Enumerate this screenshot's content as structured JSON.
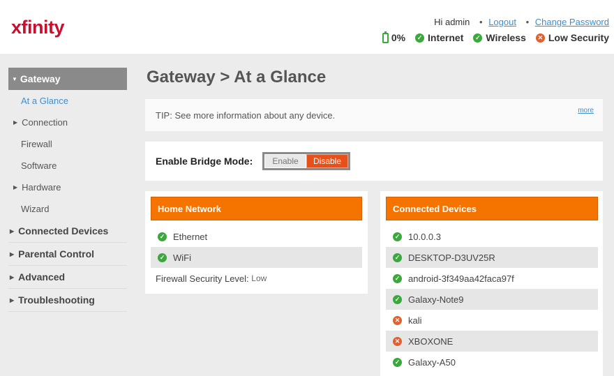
{
  "header": {
    "logo": "xfinity",
    "greeting": "Hi admin",
    "logout": "Logout",
    "change_password": "Change Password",
    "status": {
      "battery": "0%",
      "internet": "Internet",
      "wireless": "Wireless",
      "security": "Low Security"
    }
  },
  "sidebar": {
    "gateway": "Gateway",
    "sub_items": {
      "at_a_glance": "At a Glance",
      "connection": "Connection",
      "firewall": "Firewall",
      "software": "Software",
      "hardware": "Hardware",
      "wizard": "Wizard"
    },
    "main_items": {
      "connected_devices": "Connected Devices",
      "parental_control": "Parental Control",
      "advanced": "Advanced",
      "troubleshooting": "Troubleshooting"
    }
  },
  "main": {
    "title": "Gateway > At a Glance",
    "tip": "TIP: See more information about any device.",
    "more": "more",
    "bridge_label": "Enable Bridge Mode:",
    "bridge_enable": "Enable",
    "bridge_disable": "Disable",
    "home_network": {
      "title": "Home Network",
      "items": [
        "Ethernet",
        "WiFi"
      ],
      "firewall_label": "Firewall Security Level:",
      "firewall_value": "Low"
    },
    "connected_devices": {
      "title": "Connected Devices",
      "devices": [
        "10.0.0.3",
        "DESKTOP-D3UV25R",
        "android-3f349aa42faca97f",
        "Galaxy-Note9",
        "kali",
        "XBOXONE",
        "Galaxy-A50"
      ]
    }
  },
  "colors": {
    "accent_orange": "#f57400",
    "ok_green": "#3aa83a",
    "bad_red": "#e06030",
    "link_blue": "#3d8fd1"
  }
}
